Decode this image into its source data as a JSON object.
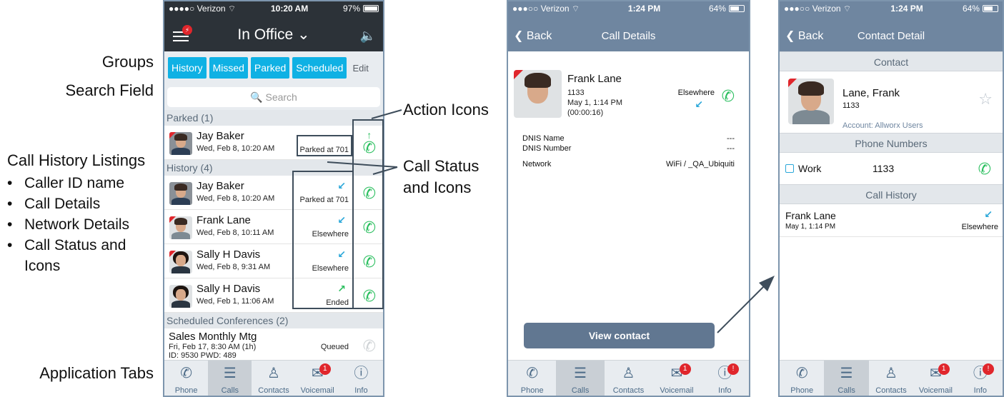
{
  "annotations": {
    "groups": "Groups",
    "search_field": "Search Field",
    "call_history_listings": "Call History Listings",
    "bullets": [
      "Caller ID name",
      "Call Details",
      "Network Details",
      "Call Status and",
      "Icons"
    ],
    "application_tabs": "Application Tabs",
    "action_icons": "Action Icons",
    "call_status_1": "Call Status",
    "call_status_2": "and Icons"
  },
  "phone1": {
    "status": {
      "carrier": "●●●●○ Verizon ⌔",
      "time": "10:20 AM",
      "battery": "97%"
    },
    "title": "In Office ⌄",
    "menu_badge": "⚡",
    "groups": [
      "History",
      "Missed",
      "Parked",
      "Scheduled"
    ],
    "edit": "Edit",
    "search_placeholder": "🔍 Search",
    "sections": {
      "parked": "Parked (1)",
      "history": "History (4)",
      "scheduled": "Scheduled Conferences (2)"
    },
    "parked_row": {
      "name": "Jay Baker",
      "date": "Wed, Feb 8, 10:20 AM",
      "status": "Parked at 701"
    },
    "history_rows": [
      {
        "name": "Jay Baker",
        "date": "Wed, Feb 8, 10:20 AM",
        "status": "Parked at 701",
        "arrow": "↙"
      },
      {
        "name": "Frank Lane",
        "date": "Wed, Feb 8, 10:11 AM",
        "status": "Elsewhere",
        "arrow": "↙"
      },
      {
        "name": "Sally H Davis",
        "date": "Wed, Feb 8, 9:31 AM",
        "status": "Elsewhere",
        "arrow": "↙"
      },
      {
        "name": "Sally H Davis",
        "date": "Wed, Feb 1, 11:06 AM",
        "status": "Ended",
        "arrow": "↗"
      }
    ],
    "conference": {
      "name": "Sales Monthly Mtg",
      "date": "Fri, Feb 17, 8:30 AM (1h)",
      "ids": "ID: 9530   PWD: 489",
      "status": "Queued"
    },
    "tabs": [
      {
        "label": "Phone",
        "icon": "✆"
      },
      {
        "label": "Calls",
        "icon": "☰"
      },
      {
        "label": "Contacts",
        "icon": "♙"
      },
      {
        "label": "Voicemail",
        "icon": "✉",
        "badge": "1"
      },
      {
        "label": "Info",
        "icon": "ⓘ"
      }
    ]
  },
  "phone2": {
    "status": {
      "carrier": "●●●○○ Verizon ⌔",
      "time": "1:24 PM",
      "battery": "64%"
    },
    "back": "❮ Back",
    "title": "Call Details",
    "contact": {
      "name": "Frank Lane",
      "ext": "1133",
      "date": "May 1, 1:14 PM",
      "duration": "(00:00:16)",
      "status": "Elsewhere"
    },
    "details": [
      {
        "key": "DNIS Name",
        "value": "---"
      },
      {
        "key": "DNIS Number",
        "value": "---"
      },
      {
        "key": "Network",
        "value": "WiFi / _QA_Ubiquiti"
      }
    ],
    "view_contact": "View contact",
    "tabs": [
      {
        "label": "Phone",
        "icon": "✆"
      },
      {
        "label": "Calls",
        "icon": "☰"
      },
      {
        "label": "Contacts",
        "icon": "♙"
      },
      {
        "label": "Voicemail",
        "icon": "✉",
        "badge": "1"
      },
      {
        "label": "Info",
        "icon": "ⓘ",
        "badge": "!"
      }
    ]
  },
  "phone3": {
    "status": {
      "carrier": "●●●○○ Verizon ⌔",
      "time": "1:24 PM",
      "battery": "64%"
    },
    "back": "❮ Back",
    "title": "Contact Detail",
    "sections": {
      "contact": "Contact",
      "phone_numbers": "Phone Numbers",
      "call_history": "Call History"
    },
    "contact": {
      "name": "Lane, Frank",
      "ext": "1133",
      "account": "Account: Allworx Users"
    },
    "phone": {
      "label": "Work",
      "number": "1133"
    },
    "history": {
      "name": "Frank Lane",
      "date": "May 1, 1:14 PM",
      "status": "Elsewhere"
    },
    "tabs": [
      {
        "label": "Phone",
        "icon": "✆"
      },
      {
        "label": "Calls",
        "icon": "☰"
      },
      {
        "label": "Contacts",
        "icon": "♙"
      },
      {
        "label": "Voicemail",
        "icon": "✉",
        "badge": "1"
      },
      {
        "label": "Info",
        "icon": "ⓘ",
        "badge": "!"
      }
    ]
  },
  "colors": {
    "accent": "#0fb1e4",
    "call_green": "#2bbf5f",
    "nav_blue": "#6f86a0",
    "dark_header": "#2c3238",
    "badge_red": "#e0262c"
  }
}
